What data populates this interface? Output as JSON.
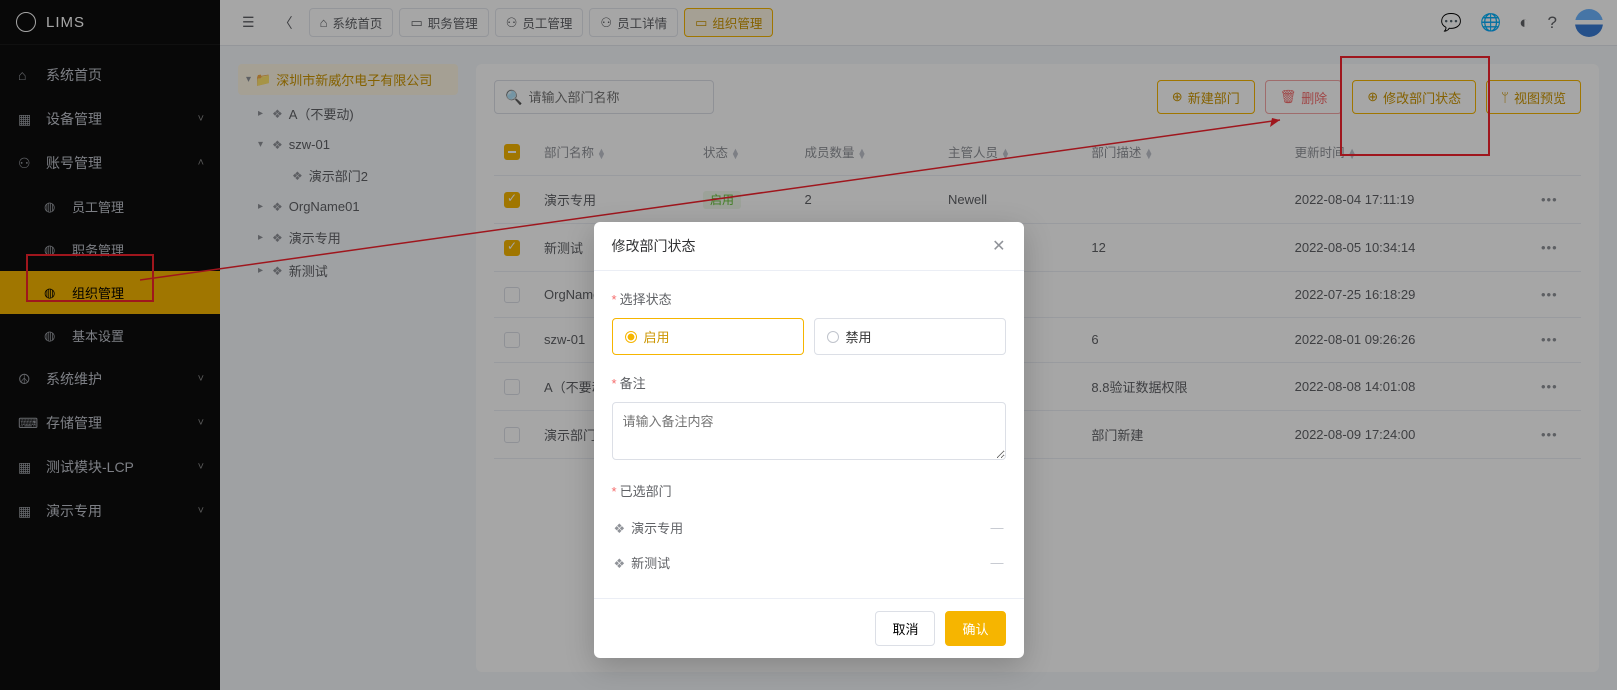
{
  "brand": "LIMS",
  "sidebar": {
    "items": [
      {
        "label": "系统首页",
        "icon": "home"
      },
      {
        "label": "设备管理",
        "icon": "grid",
        "expandable": true
      },
      {
        "label": "账号管理",
        "icon": "users",
        "expandable": true,
        "open": true,
        "children": [
          {
            "label": "员工管理"
          },
          {
            "label": "职务管理"
          },
          {
            "label": "组织管理",
            "active": true
          },
          {
            "label": "基本设置"
          }
        ]
      },
      {
        "label": "系统维护",
        "icon": "peace",
        "expandable": true
      },
      {
        "label": "存储管理",
        "icon": "keyboard",
        "expandable": true
      },
      {
        "label": "测试模块-LCP",
        "icon": "grid",
        "expandable": true
      },
      {
        "label": "演示专用",
        "icon": "grid",
        "expandable": true
      }
    ]
  },
  "breadcrumbs": [
    {
      "label": "系统首页",
      "icon": "home"
    },
    {
      "label": "职务管理",
      "icon": "badge"
    },
    {
      "label": "员工管理",
      "icon": "users"
    },
    {
      "label": "员工详情",
      "icon": "users"
    },
    {
      "label": "组织管理",
      "icon": "badge",
      "active": true
    }
  ],
  "tree": {
    "root": "深圳市新威尔电子有限公司",
    "nodes": [
      {
        "label": "A（不要动)",
        "level": 1
      },
      {
        "label": "szw-01",
        "level": 1,
        "open": true
      },
      {
        "label": "演示部门2",
        "level": 2
      },
      {
        "label": "OrgName01",
        "level": 1
      },
      {
        "label": "演示专用",
        "level": 1
      },
      {
        "label": "新测试",
        "level": 1
      }
    ]
  },
  "toolbar": {
    "search_placeholder": "请输入部门名称",
    "new_btn": "新建部门",
    "delete_btn": "删除",
    "status_btn": "修改部门状态",
    "preview_btn": "视图预览"
  },
  "table": {
    "columns": [
      "部门名称",
      "状态",
      "成员数量",
      "主管人员",
      "部门描述",
      "更新时间"
    ],
    "rows": [
      {
        "checked": true,
        "name": "演示专用",
        "status": "启用",
        "count": "2",
        "manager": "Newell",
        "desc": "",
        "time": "2022-08-04 17:11:19"
      },
      {
        "checked": true,
        "name": "新测试",
        "status": "",
        "count": "",
        "manager": "",
        "desc": "12",
        "time": "2022-08-05 10:34:14"
      },
      {
        "checked": false,
        "name": "OrgName01",
        "status": "",
        "count": "",
        "manager": "",
        "desc": "",
        "time": "2022-07-25 16:18:29"
      },
      {
        "checked": false,
        "name": "szw-01",
        "status": "",
        "count": "",
        "manager": "",
        "desc": "6",
        "time": "2022-08-01 09:26:26"
      },
      {
        "checked": false,
        "name": "A（不要动)",
        "status": "",
        "count": "",
        "manager": "",
        "desc": "8.8验证数据权限",
        "time": "2022-08-08 14:01:08"
      },
      {
        "checked": false,
        "name": "演示部门2",
        "status": "",
        "count": "",
        "manager": "",
        "desc": "部门新建",
        "time": "2022-08-09 17:24:00"
      }
    ]
  },
  "modal": {
    "title": "修改部门状态",
    "status_label": "选择状态",
    "opt_enable": "启用",
    "opt_disable": "禁用",
    "remark_label": "备注",
    "remark_placeholder": "请输入备注内容",
    "selected_label": "已选部门",
    "selected": [
      "演示专用",
      "新测试"
    ],
    "cancel": "取消",
    "confirm": "确认"
  }
}
